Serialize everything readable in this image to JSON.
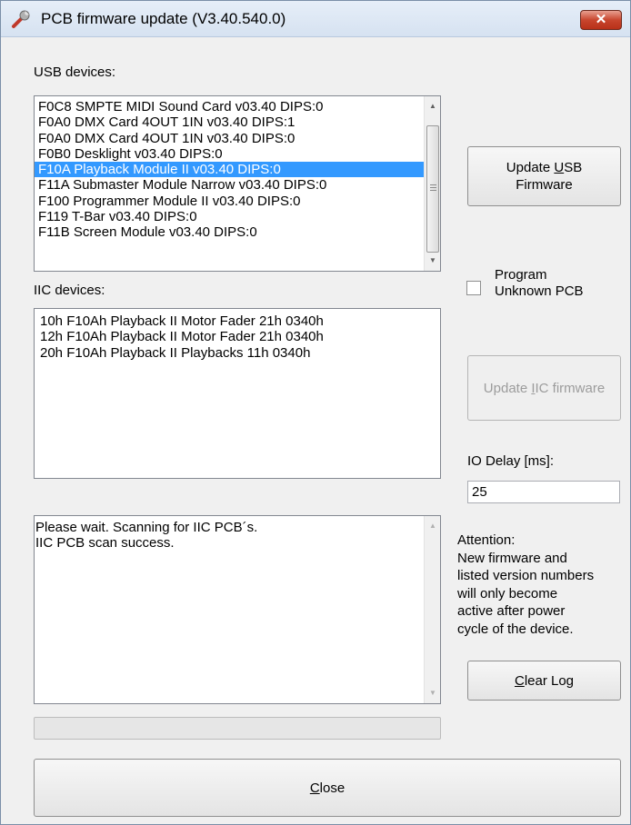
{
  "window": {
    "title": "PCB firmware update (V3.40.540.0)",
    "close_glyph": "✕"
  },
  "usb": {
    "label": "USB devices:",
    "items": [
      "F0C8  SMPTE MIDI Sound Card  v03.40  DIPS:0",
      "F0A0  DMX Card 4OUT 1IN  v03.40  DIPS:1",
      "F0A0  DMX Card 4OUT 1IN  v03.40  DIPS:0",
      "F0B0  Desklight  v03.40  DIPS:0",
      "F10A  Playback Module II  v03.40  DIPS:0",
      "F11A  Submaster Module Narrow  v03.40  DIPS:0",
      "F100  Programmer Module II  v03.40  DIPS:0",
      "F119  T-Bar  v03.40  DIPS:0",
      "F11B  Screen Module  v03.40  DIPS:0"
    ],
    "selected_index": 4,
    "update_button": {
      "before": "Update ",
      "mnemonic": "U",
      "after": "SB",
      "line2": "Firmware"
    }
  },
  "program_unknown": {
    "line1": "Program",
    "line2": "Unknown PCB",
    "checked": false
  },
  "iic": {
    "label": "IIC devices:",
    "items": [
      "10h  F10Ah  Playback II Motor Fader 21h  0340h",
      "12h  F10Ah  Playback II Motor Fader 21h  0340h",
      "20h  F10Ah  Playback II Playbacks 11h  0340h"
    ],
    "update_button": {
      "before": "Update ",
      "mnemonic": "I",
      "after": "IC firmware",
      "enabled": false
    }
  },
  "io_delay": {
    "label": "IO Delay [ms]:",
    "value": "25"
  },
  "log": {
    "lines": [
      "Please wait. Scanning for IIC PCB´s.",
      "IIC PCB scan success."
    ]
  },
  "attention": {
    "lines": [
      "Attention:",
      "New firmware and",
      "listed version numbers",
      "will only become",
      "active after power",
      "cycle of the device."
    ]
  },
  "clear_log": {
    "mnemonic": "C",
    "rest": "lear Log"
  },
  "close": {
    "mnemonic": "C",
    "rest": "lose"
  },
  "progress": {
    "value": 0
  },
  "colors": {
    "selection": "#3399ff",
    "title_bg": "#dbe6f4",
    "window_bg": "#f0f0f0"
  }
}
